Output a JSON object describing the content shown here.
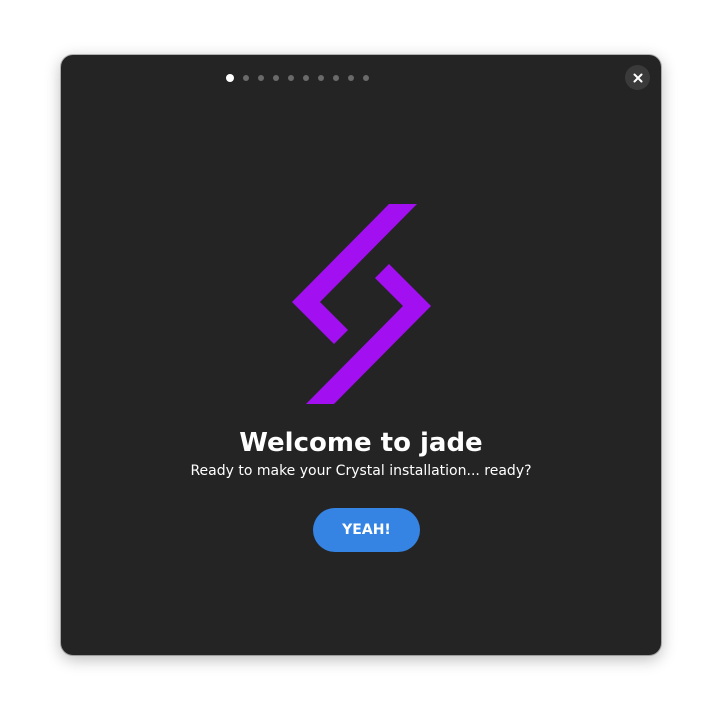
{
  "window": {
    "title": "Welcome to jade",
    "subtitle": "Ready to make your Crystal installation... ready?",
    "cta_label": "YEAH!",
    "close_icon": "close-icon",
    "logo_icon": "jade-logo-icon"
  },
  "pager": {
    "total_pages": 10,
    "current_page": 1
  },
  "colors": {
    "window_bg": "#242424",
    "accent": "#3584e4",
    "logo": "#a20ff0",
    "dot_inactive": "#6a6a6a",
    "dot_active": "#ffffff"
  }
}
